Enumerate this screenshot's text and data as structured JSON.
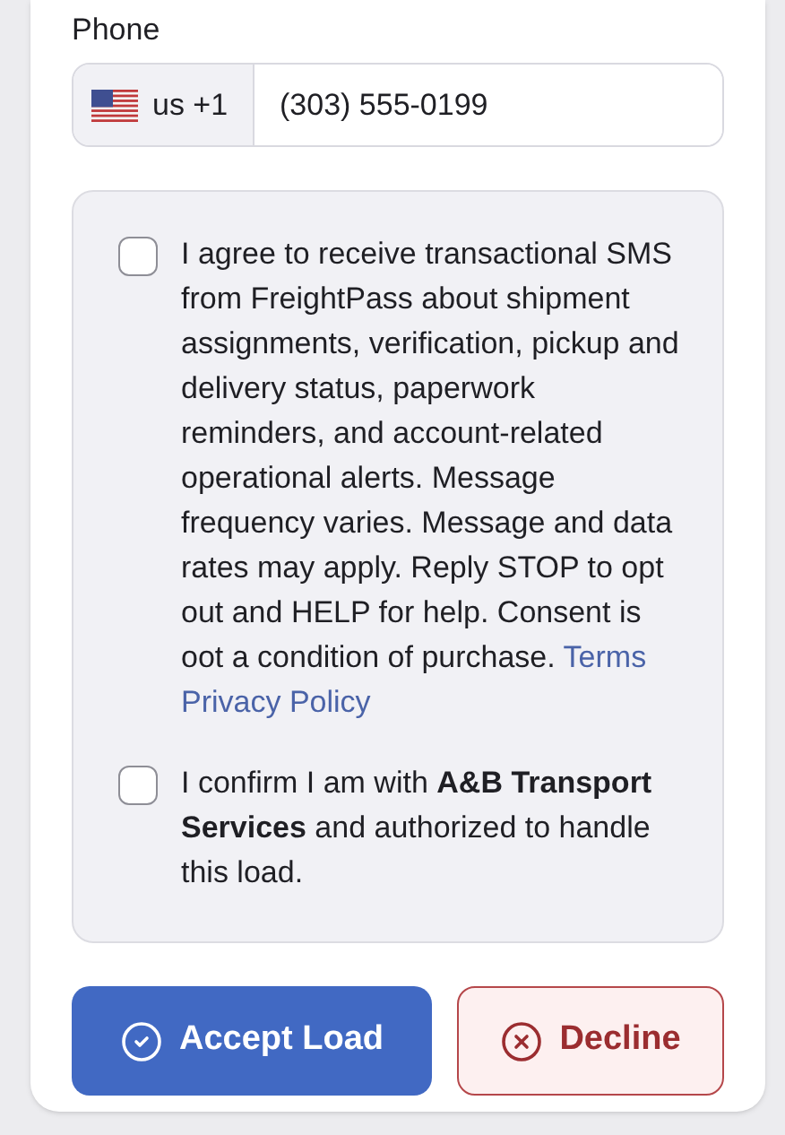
{
  "phone": {
    "label": "Phone",
    "country_code": "us +1",
    "value": "(303) 555-0199"
  },
  "consents": [
    {
      "checked": false,
      "text": "I agree to receive transactional SMS from FreightPass about shipment assignments, verification, pickup and delivery status, paperwork reminders, and account-related operational alerts. Message frequency varies. Message and data rates may apply. Reply STOP to opt out and HELP for help. Consent is oot a condition of purchase.",
      "links": [
        "Terms",
        "Privacy Policy"
      ]
    },
    {
      "checked": false,
      "text": "I confirm I am with **A&B Transport Services** and authorized to handle this load."
    }
  ],
  "actions": [
    {
      "kind": "primary",
      "label": "Accept Load"
    },
    {
      "kind": "danger",
      "label": "Decline"
    }
  ]
}
